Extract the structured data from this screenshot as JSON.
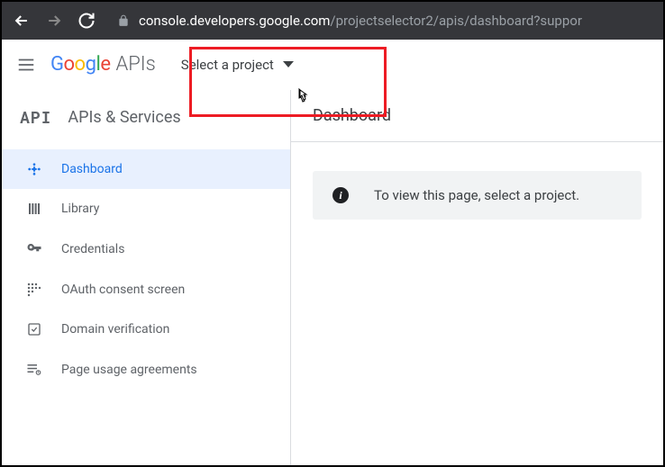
{
  "browser": {
    "url_host": "console.developers.google.com",
    "url_path": "/projectselector2/apis/dashboard?suppor"
  },
  "logo": {
    "g": "G",
    "o1": "o",
    "o2": "o",
    "g2": "g",
    "l": "l",
    "e": "e",
    "apis": "APIs"
  },
  "project_selector": {
    "label": "Select a project"
  },
  "sidebar": {
    "header_badge": "API",
    "header_text": "APIs & Services",
    "items": [
      {
        "label": "Dashboard"
      },
      {
        "label": "Library"
      },
      {
        "label": "Credentials"
      },
      {
        "label": "OAuth consent screen"
      },
      {
        "label": "Domain verification"
      },
      {
        "label": "Page usage agreements"
      }
    ]
  },
  "main": {
    "title": "Dashboard",
    "banner_text": "To view this page, select a project."
  }
}
